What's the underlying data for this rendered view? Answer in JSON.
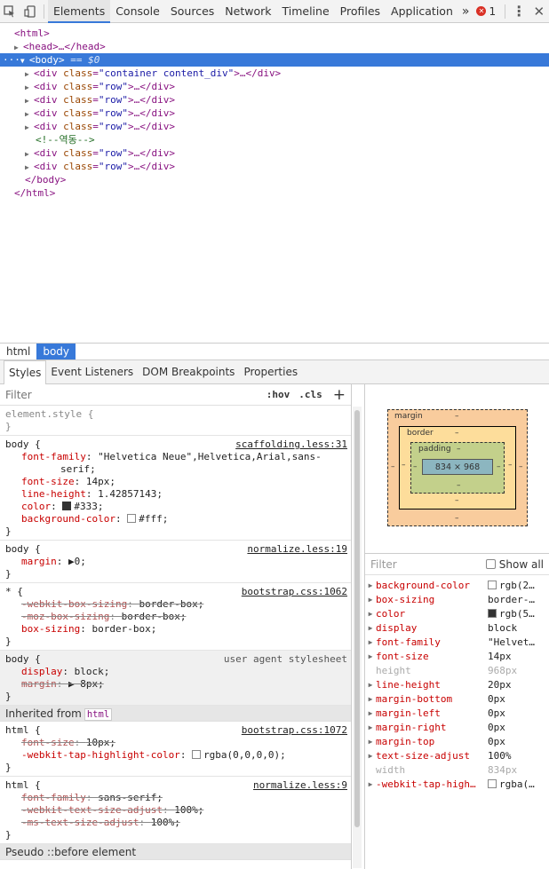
{
  "toolbar": {
    "tabs": [
      "Elements",
      "Console",
      "Sources",
      "Network",
      "Timeline",
      "Profiles",
      "Application"
    ],
    "more": "»",
    "error_count": "1",
    "error_icon": "✕",
    "menu_icon": "⋮",
    "close_icon": "✕"
  },
  "dom": {
    "html_open": "<html>",
    "head_tag": "<head>",
    "head_close": "…</head>",
    "body_prefix": "···",
    "body_tag": "<body>",
    "body_eq": " == $0",
    "children": [
      {
        "tag": "div",
        "attr": "class",
        "val": "\"container content_div\""
      },
      {
        "tag": "div",
        "attr": "class",
        "val": "\"row\""
      },
      {
        "tag": "div",
        "attr": "class",
        "val": "\"row\""
      },
      {
        "tag": "div",
        "attr": "class",
        "val": "\"row\""
      },
      {
        "tag": "div",
        "attr": "class",
        "val": "\"row\""
      }
    ],
    "comment": "<!--역동-->",
    "children2": [
      {
        "tag": "div",
        "attr": "class",
        "val": "\"row\""
      },
      {
        "tag": "div",
        "attr": "class",
        "val": "\"row\""
      }
    ],
    "body_close": "</body>",
    "html_close": "</html>"
  },
  "breadcrumbs": [
    "html",
    "body"
  ],
  "subtabs": [
    "Styles",
    "Event Listeners",
    "DOM Breakpoints",
    "Properties"
  ],
  "styles": {
    "filter_placeholder": "Filter",
    "hov": ":hov",
    "cls": ".cls",
    "plus": "+",
    "element_style": "element.style {",
    "close_brace": "}",
    "rules": [
      {
        "selector": "body {",
        "source": "scaffolding.less:31",
        "props": [
          {
            "n": "font-family",
            "v": "\"Helvetica Neue\",Helvetica,Arial,sans-"
          },
          {
            "n": "",
            "v": "serif;"
          },
          {
            "n": "font-size",
            "v": "14px;"
          },
          {
            "n": "line-height",
            "v": "1.42857143;"
          },
          {
            "n": "color",
            "v": "#333;",
            "swatch": "#333333"
          },
          {
            "n": "background-color",
            "v": "#fff;",
            "swatch": "#ffffff"
          }
        ]
      },
      {
        "selector": "body {",
        "source": "normalize.less:19",
        "props": [
          {
            "n": "margin",
            "v": "▶0;"
          }
        ]
      },
      {
        "selector": "* {",
        "source": "bootstrap.css:1062",
        "props": [
          {
            "n": "-webkit-box-sizing",
            "v": "border-box;",
            "strike": true
          },
          {
            "n": "-moz-box-sizing",
            "v": "border-box;",
            "strike": true
          },
          {
            "n": "box-sizing",
            "v": "border-box;"
          }
        ]
      },
      {
        "selector": "body {",
        "source": "user agent stylesheet",
        "ua": true,
        "props": [
          {
            "n": "display",
            "v": "block;"
          },
          {
            "n": "margin",
            "v": "▶ 8px;",
            "strike": true
          }
        ]
      }
    ],
    "inherited_label": "Inherited from",
    "inherited_tag": "html",
    "rules2": [
      {
        "selector": "html {",
        "source": "bootstrap.css:1072",
        "props": [
          {
            "n": "font-size",
            "v": "10px;",
            "strike": true
          },
          {
            "n": "-webkit-tap-highlight-color",
            "v": "rgba(0,0,0,0);",
            "swatch": "#ffffff"
          }
        ]
      },
      {
        "selector": "html {",
        "source": "normalize.less:9",
        "props": [
          {
            "n": "font-family",
            "v": "sans-serif;",
            "strike": true
          },
          {
            "n": "-webkit-text-size-adjust",
            "v": "100%;",
            "strike": true
          },
          {
            "n": "-ms-text-size-adjust",
            "v": "100%;",
            "strike": true
          }
        ]
      }
    ],
    "pseudo_label": "Pseudo ::before element"
  },
  "boxmodel": {
    "margin_label": "margin",
    "border_label": "border",
    "padding_label": "padding",
    "dash": "–",
    "content_size": "834 × 968",
    "colors": {
      "margin": "#f9cc9d",
      "border": "#fddd9b",
      "padding": "#c3d08b",
      "content": "#8cb6c0"
    }
  },
  "computed": {
    "filter_placeholder": "Filter",
    "show_all": "Show all",
    "rows": [
      {
        "n": "background-color",
        "v": "rgb(2…",
        "swatch": "#ffffff"
      },
      {
        "n": "box-sizing",
        "v": "border-…"
      },
      {
        "n": "color",
        "v": "rgb(5…",
        "swatch": "#333333"
      },
      {
        "n": "display",
        "v": "block"
      },
      {
        "n": "font-family",
        "v": "\"Helvet…"
      },
      {
        "n": "font-size",
        "v": "14px"
      },
      {
        "n": "height",
        "v": "968px",
        "inh": true
      },
      {
        "n": "line-height",
        "v": "20px"
      },
      {
        "n": "margin-bottom",
        "v": "0px"
      },
      {
        "n": "margin-left",
        "v": "0px"
      },
      {
        "n": "margin-right",
        "v": "0px"
      },
      {
        "n": "margin-top",
        "v": "0px"
      },
      {
        "n": "text-size-adjust",
        "v": "100%"
      },
      {
        "n": "width",
        "v": "834px",
        "inh": true
      },
      {
        "n": "-webkit-tap-high…",
        "v": "rgba(…",
        "swatch": "#ffffff"
      }
    ]
  }
}
